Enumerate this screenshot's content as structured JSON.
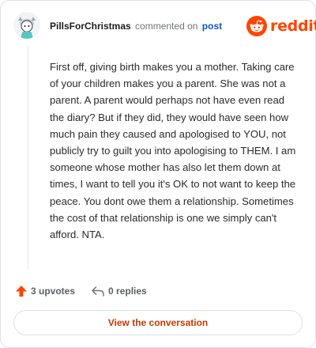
{
  "header": {
    "username": "PillsForChristmas",
    "verb": "commented on",
    "post_link": "post"
  },
  "logo": {
    "wordmark": "reddit",
    "brand_color": "#ff4500",
    "icon": "reddit-snoo-icon"
  },
  "comment": {
    "body": "First off, giving birth makes you a mother. Taking care of your children makes you a parent. She was not a parent. A parent would perhaps not have even read the diary? But if they did, they would have seen how much pain they caused and apologised to YOU, not publicly try to guilt you into apologising to THEM. I am someone whose mother has also let them down at times, I want to tell you it's OK to not want to keep the peace. You dont owe them a relationship. Sometimes the cost of that relationship is one we simply can't afford. NTA."
  },
  "actions": {
    "upvotes_label": "3 upvotes",
    "upvote_icon": "upvote-arrow-icon",
    "replies_label": "0 replies",
    "reply_icon": "reply-arrow-icon"
  },
  "footer": {
    "button_label": "View the conversation",
    "accent": "#c43a00"
  }
}
